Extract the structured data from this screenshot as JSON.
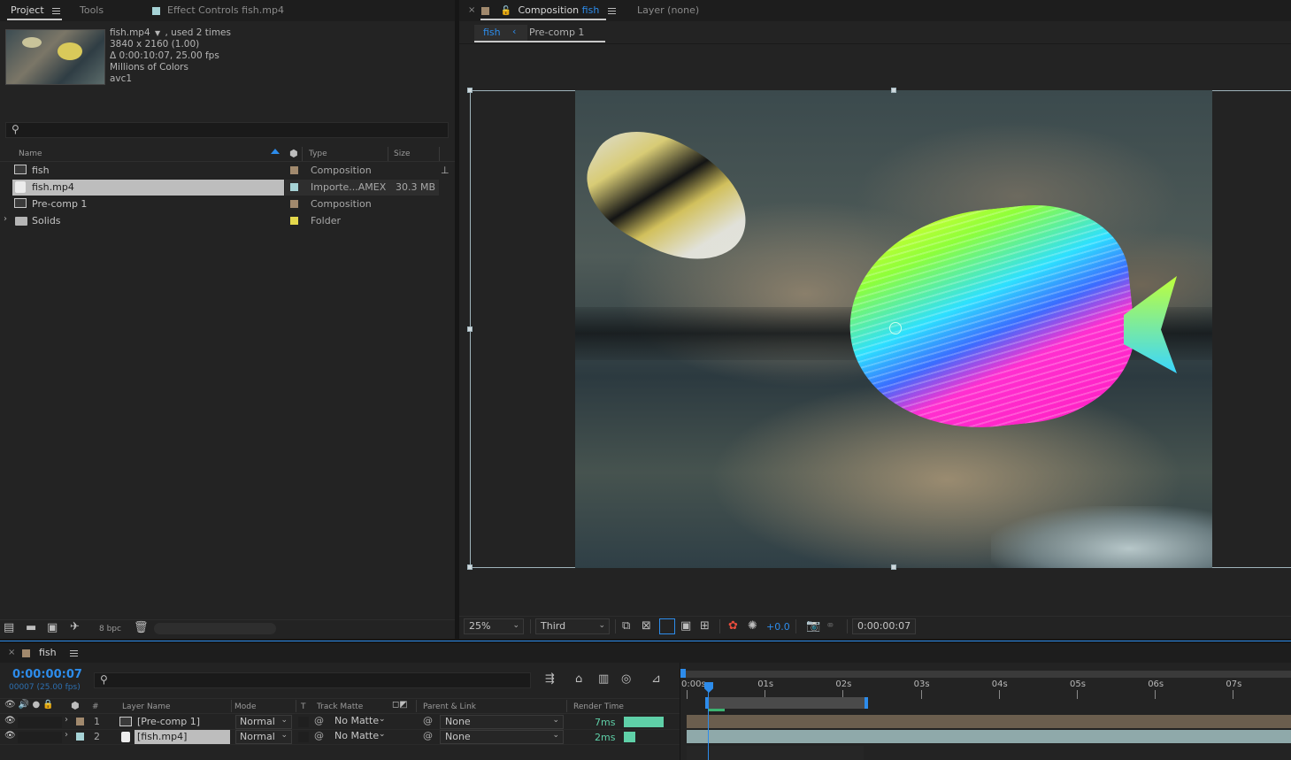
{
  "project_panel": {
    "tabs": [
      "Project",
      "Tools"
    ],
    "effect_controls_tab": "Effect Controls fish.mp4",
    "footage": {
      "name": "fish.mp4",
      "used": ", used 2 times",
      "resolution": "3840 x 2160 (1.00)",
      "duration": "Δ 0:00:10:07, 25.00 fps",
      "colors": "Millions of Colors",
      "codec": "avc1"
    },
    "search_placeholder": "",
    "columns": {
      "name": "Name",
      "type": "Type",
      "size": "Size"
    },
    "items": [
      {
        "name": "fish",
        "type": "Composition",
        "size": "",
        "label_color": "#a1896d"
      },
      {
        "name": "fish.mp4",
        "type": "Importe...AMEX",
        "size": "30.3 MB",
        "label_color": "#a6d3d6"
      },
      {
        "name": "Pre-comp 1",
        "type": "Composition",
        "size": "",
        "label_color": "#a1896d"
      },
      {
        "name": "Solids",
        "type": "Folder",
        "size": "",
        "label_color": "#e4d84c"
      }
    ],
    "bpc": "8 bpc"
  },
  "comp_panel": {
    "tab_label": "Composition",
    "tab_comp_name": "fish",
    "layer_tab": "Layer (none)",
    "breadcrumb": [
      "fish",
      "Pre-comp 1"
    ],
    "zoom": "25%",
    "view_layout": "Third",
    "exposure": "+0.0",
    "timecode": "0:00:00:07"
  },
  "timeline": {
    "tab_label": "fish",
    "timecode": "0:00:00:07",
    "frame_info": "00007 (25.00 fps)",
    "columns": {
      "number": "#",
      "layer_name": "Layer Name",
      "mode": "Mode",
      "t": "T",
      "track_matte": "Track Matte",
      "parent": "Parent & Link",
      "render_time": "Render Time"
    },
    "layers": [
      {
        "num": "1",
        "name": "[Pre-comp 1]",
        "mode": "Normal",
        "matte": "No Matte",
        "parent": "None",
        "render": "7ms",
        "render_frac": 1.0,
        "label_color": "#a1896d",
        "bar_color": "#6b5e4e"
      },
      {
        "num": "2",
        "name": "[fish.mp4]",
        "mode": "Normal",
        "matte": "No Matte",
        "parent": "None",
        "render": "2ms",
        "render_frac": 0.28,
        "label_color": "#a6d3d6",
        "bar_color": "#8fa9aa"
      }
    ],
    "ruler": [
      "0:00s",
      "01s",
      "02s",
      "03s",
      "04s",
      "05s",
      "06s",
      "07s"
    ],
    "accent": "#2d8ceb"
  }
}
